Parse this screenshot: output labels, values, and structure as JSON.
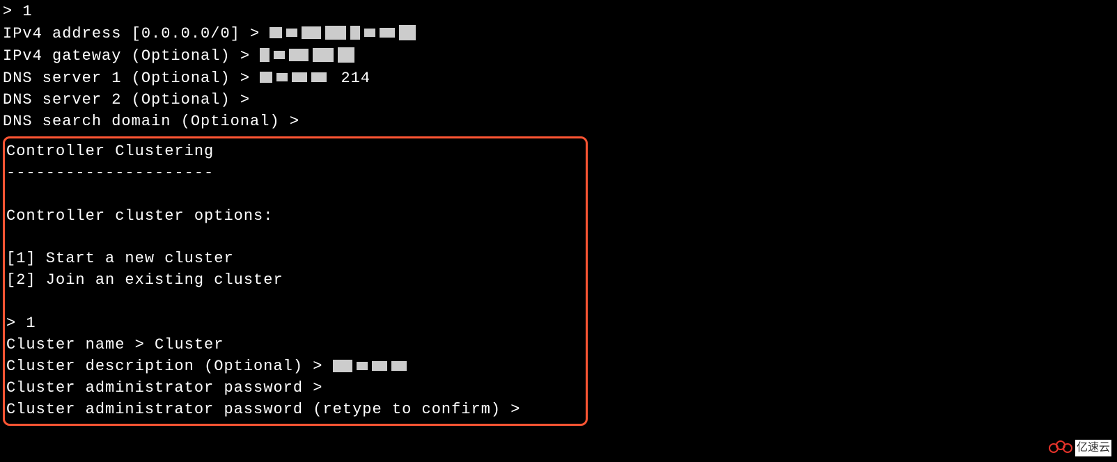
{
  "top": {
    "prompt_input": "> 1",
    "ipv4_address_label": "IPv4 address [0.0.0.0/0] > ",
    "ipv4_gateway_label": "IPv4 gateway (Optional) > ",
    "dns1_label": "DNS server 1 (Optional) > ",
    "dns1_value_suffix": " 214",
    "dns2_label": "DNS server 2 (Optional) > ",
    "dns_search_label": "DNS search domain (Optional) >"
  },
  "clustering": {
    "title": "Controller Clustering",
    "divider": "---------------------",
    "options_title": "Controller cluster options:",
    "option1": "[1] Start a new cluster",
    "option2": "[2] Join an existing cluster",
    "prompt_input": "> 1",
    "cluster_name_label": "Cluster name > ",
    "cluster_name_value": "Cluster",
    "cluster_desc_label": "Cluster description (Optional) > ",
    "admin_pass_label": "Cluster administrator password >",
    "admin_pass_confirm_label": "Cluster administrator password (retype to confirm) >"
  },
  "watermark": {
    "text": "亿速云"
  }
}
